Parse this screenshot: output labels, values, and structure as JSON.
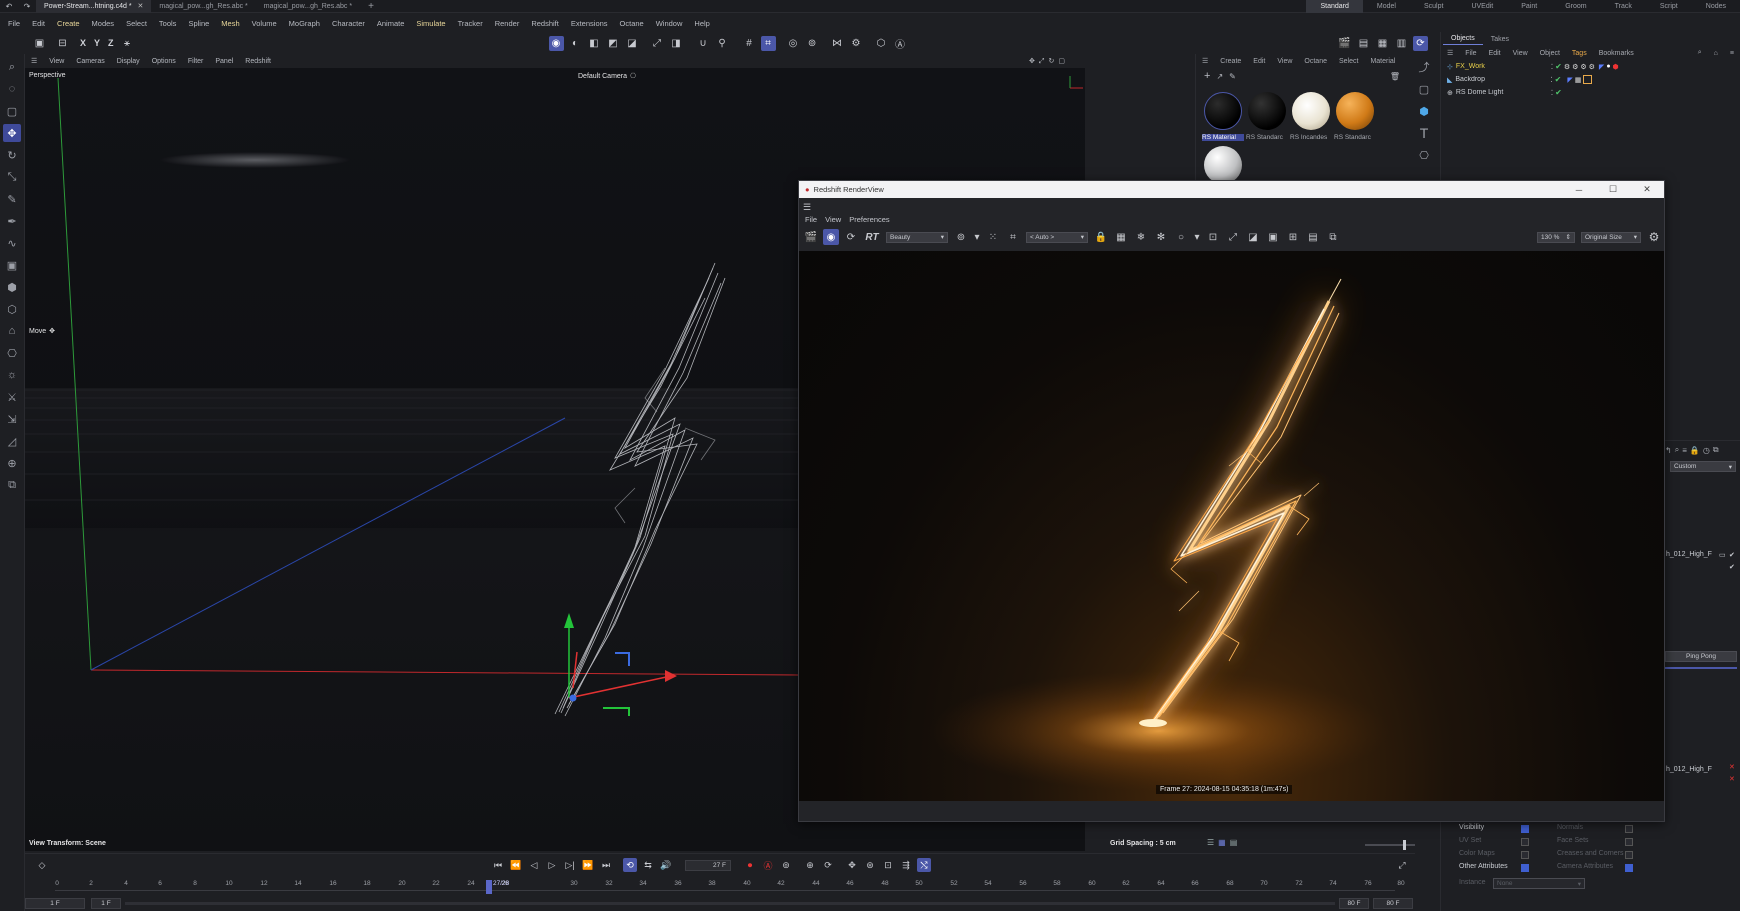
{
  "titlebar": {
    "tabs": [
      {
        "label": "Power-Stream...htning.c4d *",
        "active": true
      },
      {
        "label": "magical_pow...gh_Res.abc *",
        "active": false
      },
      {
        "label": "magical_pow...gh_Res.abc *",
        "active": false
      }
    ],
    "layouts": [
      "Standard",
      "Model",
      "Sculpt",
      "UVEdit",
      "Paint",
      "Groom",
      "Track",
      "Script",
      "Nodes"
    ],
    "active_layout": "Standard"
  },
  "menubar": [
    "File",
    "Edit",
    "Create",
    "Modes",
    "Select",
    "Tools",
    "Spline",
    "Mesh",
    "Volume",
    "MoGraph",
    "Character",
    "Animate",
    "Simulate",
    "Tracker",
    "Render",
    "Redshift",
    "Extensions",
    "Octane",
    "Window",
    "Help"
  ],
  "toolbar": {
    "axis_x": "X",
    "axis_y": "Y",
    "axis_z": "Z"
  },
  "viewport": {
    "menu": [
      "View",
      "Cameras",
      "Display",
      "Options",
      "Filter",
      "Panel",
      "Redshift"
    ],
    "projection": "Perspective",
    "camera": "Default Camera",
    "tool": "Move",
    "view_transform": "View Transform: Scene",
    "grid_spacing": "Grid Spacing : 5 cm"
  },
  "material_panel": {
    "menu": [
      "Create",
      "Edit",
      "View",
      "Octane",
      "Select",
      "Material"
    ],
    "materials": [
      {
        "label": "RS Material",
        "color": "#0a0a0a"
      },
      {
        "label": "RS Standarc",
        "color": "#0c0c0c"
      },
      {
        "label": "RS Incandes",
        "color": "#f2efe6"
      },
      {
        "label": "RS Standarc",
        "color": "#d07a17"
      },
      {
        "label": "",
        "color": "#bfc0c2"
      }
    ]
  },
  "objects_panel": {
    "tabs": [
      "Objects",
      "Takes"
    ],
    "menu": [
      "File",
      "Edit",
      "View",
      "Object",
      "Tags",
      "Bookmarks"
    ],
    "objects": [
      {
        "name": "FX_Work",
        "color": "#e9d04a"
      },
      {
        "name": "Backdrop",
        "color": "#c9ccd2"
      },
      {
        "name": "RS Dome Light",
        "color": "#c9ccd2"
      }
    ]
  },
  "attributes_panel": {
    "custom_dropdown": "Custom",
    "ref1": "h_012_High_F",
    "ref2": "h_012_High_F",
    "ping_pong": "Ping Pong",
    "rows_left": [
      {
        "label": "Visibility",
        "checked": true,
        "dim": false
      },
      {
        "label": "UV Set",
        "checked": false,
        "dim": true
      },
      {
        "label": "Color Maps",
        "checked": false,
        "dim": true
      },
      {
        "label": "Other Attributes",
        "checked": true,
        "dim": false
      }
    ],
    "rows_right": [
      {
        "label": "Normals",
        "checked": false
      },
      {
        "label": "Face Sets",
        "checked": false
      },
      {
        "label": "Creases and Corners",
        "checked": false
      },
      {
        "label": "Camera Attributes",
        "checked": true
      }
    ],
    "instance_label": "Instance",
    "instance_value": "None"
  },
  "renderview": {
    "title": "Redshift RenderView",
    "menu": [
      "File",
      "View",
      "Preferences"
    ],
    "aov": "Beauty",
    "auto": "< Auto >",
    "zoom": "130 %",
    "size": "Original Size",
    "rt_label": "RT",
    "frame_info": "Frame  27:  2024-08-15  04:35:18  (1m:47s)"
  },
  "timeline": {
    "ticks": [
      "0",
      "2",
      "4",
      "6",
      "8",
      "10",
      "12",
      "14",
      "16",
      "18",
      "20",
      "22",
      "24",
      "26",
      "28",
      "30",
      "32",
      "34",
      "36",
      "38",
      "40",
      "42",
      "44",
      "46",
      "48",
      "50",
      "52",
      "54",
      "56",
      "58",
      "60",
      "62",
      "64",
      "66",
      "68",
      "70",
      "72",
      "74",
      "76",
      "78",
      "80"
    ],
    "current_frame": "27 F",
    "playhead_label": "27/28",
    "start_a": "1 F",
    "start_b": "1 F",
    "end_a": "80 F",
    "end_b": "80 F"
  }
}
